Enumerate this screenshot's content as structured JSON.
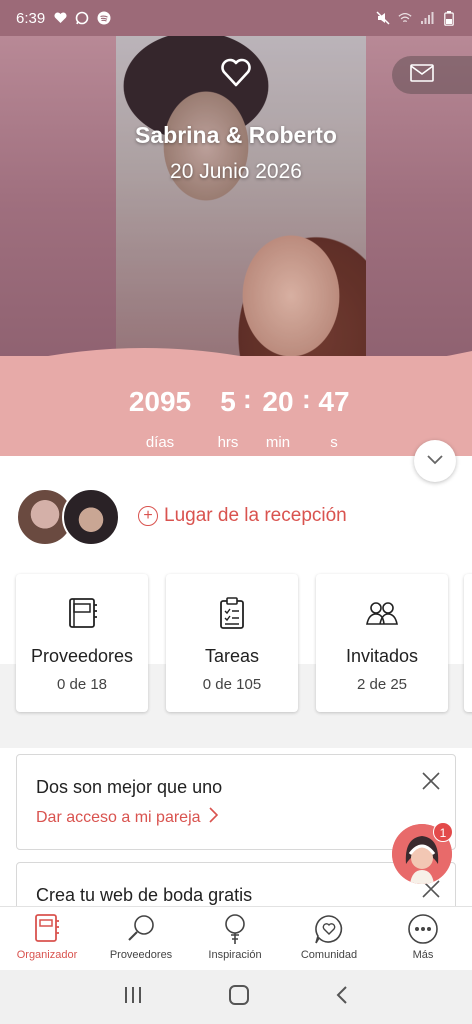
{
  "status_bar": {
    "time": "6:39",
    "left_icons": [
      "heart-icon",
      "whatsapp-icon",
      "spotify-icon"
    ],
    "right_icons": [
      "mute-icon",
      "wifi-icon",
      "signal-icon",
      "battery-icon"
    ]
  },
  "hero": {
    "couple_names": "Sabrina & Roberto",
    "wedding_date": "20 Junio 2026",
    "countdown": {
      "days": "2095",
      "hours": "5",
      "minutes": "20",
      "seconds": "47",
      "days_label": "días",
      "hours_label": "hrs",
      "minutes_label": "min",
      "seconds_label": "s",
      "separator": ":"
    }
  },
  "venue": {
    "label": "Lugar de la recepción"
  },
  "cards": [
    {
      "title": "Proveedores",
      "count": "0 de 18",
      "icon": "notebook-icon"
    },
    {
      "title": "Tareas",
      "count": "0 de 105",
      "icon": "checklist-icon"
    },
    {
      "title": "Invitados",
      "count": "2 de 25",
      "icon": "guests-icon"
    }
  ],
  "promos": [
    {
      "title": "Dos son mejor que uno",
      "link": "Dar acceso a mi pareja"
    },
    {
      "title": "Crea tu web de boda gratis"
    }
  ],
  "chat": {
    "badge": "1"
  },
  "bottom_nav": [
    {
      "label": "Organizador",
      "icon": "notebook-icon",
      "active": true
    },
    {
      "label": "Proveedores",
      "icon": "search-icon",
      "active": false
    },
    {
      "label": "Inspiración",
      "icon": "bulb-icon",
      "active": false
    },
    {
      "label": "Comunidad",
      "icon": "chat-heart-icon",
      "active": false
    },
    {
      "label": "Más",
      "icon": "more-icon",
      "active": false
    }
  ],
  "colors": {
    "accent": "#d9534f",
    "hero_band": "#e7aaa8",
    "hero_top": "#9c6a78"
  }
}
